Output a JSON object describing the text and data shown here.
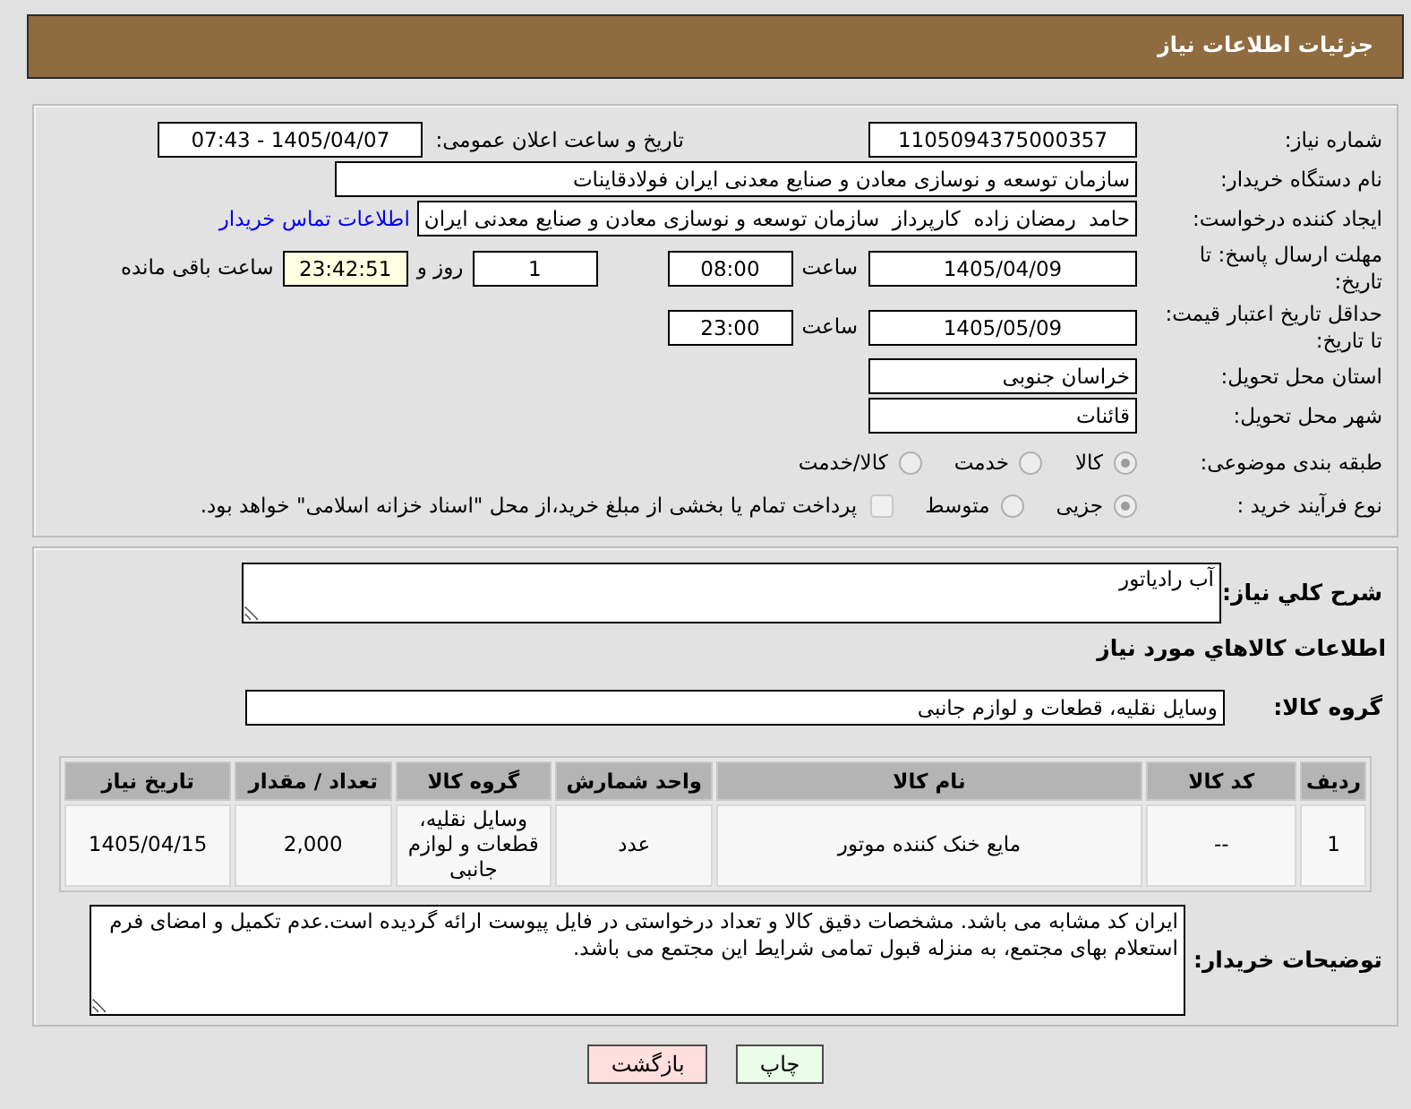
{
  "header": {
    "title": "جزئیات اطلاعات نیاز"
  },
  "need_number": {
    "label": "شماره نیاز:",
    "value": "1105094375000357"
  },
  "announcement": {
    "label": "تاریخ و ساعت اعلان عمومی:",
    "value": "1405/04/07 - 07:43"
  },
  "buyer_org": {
    "label": "نام دستگاه خریدار:",
    "value": "سازمان توسعه و نوسازی معادن و صنایع معدنی ایران فولادقاینات"
  },
  "requester": {
    "label": "ایجاد کننده درخواست:",
    "value": "حامد  رمضان زاده  کارپرداز  سازمان توسعه و نوسازی معادن و صنایع معدنی ایران",
    "contact_link": "اطلاعات تماس خریدار"
  },
  "reply_deadline": {
    "label": "مهلت ارسال پاسخ: تا تاریخ:",
    "date": "1405/04/09",
    "time_label": "ساعت",
    "time": "08:00",
    "days": "1",
    "days_label": "روز و",
    "remaining": "23:42:51",
    "remaining_label": "ساعت باقی مانده"
  },
  "price_validity": {
    "label": "حداقل تاریخ اعتبار قیمت: تا تاریخ:",
    "date": "1405/05/09",
    "time_label": "ساعت",
    "time": "23:00"
  },
  "delivery_province": {
    "label": "استان محل تحویل:",
    "value": "خراسان جنوبی"
  },
  "delivery_city": {
    "label": "شهر محل تحویل:",
    "value": "قائنات"
  },
  "subject_category": {
    "label": "طبقه بندی موضوعی:",
    "options": [
      {
        "label": "کالا",
        "selected": true,
        "disabled": true
      },
      {
        "label": "خدمت",
        "selected": false,
        "disabled": true
      },
      {
        "label": "کالا/خدمت",
        "selected": false,
        "disabled": true
      }
    ]
  },
  "purchase_process": {
    "label": "نوع فرآیند خرید :",
    "options": [
      {
        "label": "جزیی",
        "selected": true,
        "disabled": true
      },
      {
        "label": "متوسط",
        "selected": false,
        "disabled": true
      }
    ],
    "treasury_payment": {
      "label": "پرداخت تمام یا بخشی از مبلغ خرید،از محل \"اسناد خزانه اسلامی\" خواهد بود.",
      "checked": false,
      "disabled": true
    }
  },
  "general_description": {
    "label": "شرح کلي نياز:",
    "value": "آب رادیاتور"
  },
  "goods_section_title": "اطلاعات کالاهاي مورد نياز",
  "goods_group": {
    "label": "گروه کالا:",
    "value": "وسایل نقلیه، قطعات و لوازم جانبی"
  },
  "goods_table": {
    "columns": [
      "ردیف",
      "کد کالا",
      "نام کالا",
      "واحد شمارش",
      "گروه کالا",
      "تعداد / مقدار",
      "تاریخ نیاز"
    ],
    "rows": [
      [
        "1",
        "--",
        "مایع خنک کننده موتور",
        "عدد",
        "وسایل نقلیه، قطعات و لوازم جانبی",
        "2,000",
        "1405/04/15"
      ]
    ]
  },
  "buyer_notes": {
    "label": "توضیحات خریدار:",
    "value": "ایران کد مشابه می باشد. مشخصات دقیق کالا و تعداد درخواستی در فایل پیوست ارائه گردیده است.عدم تکمیل و امضای فرم استعلام بهای مجتمع، به منزله قبول تمامی شرایط این مجتمع می باشد."
  },
  "buttons": [
    {
      "label": "چاپ",
      "kind": "print"
    },
    {
      "label": "بازگشت",
      "kind": "back"
    }
  ]
}
